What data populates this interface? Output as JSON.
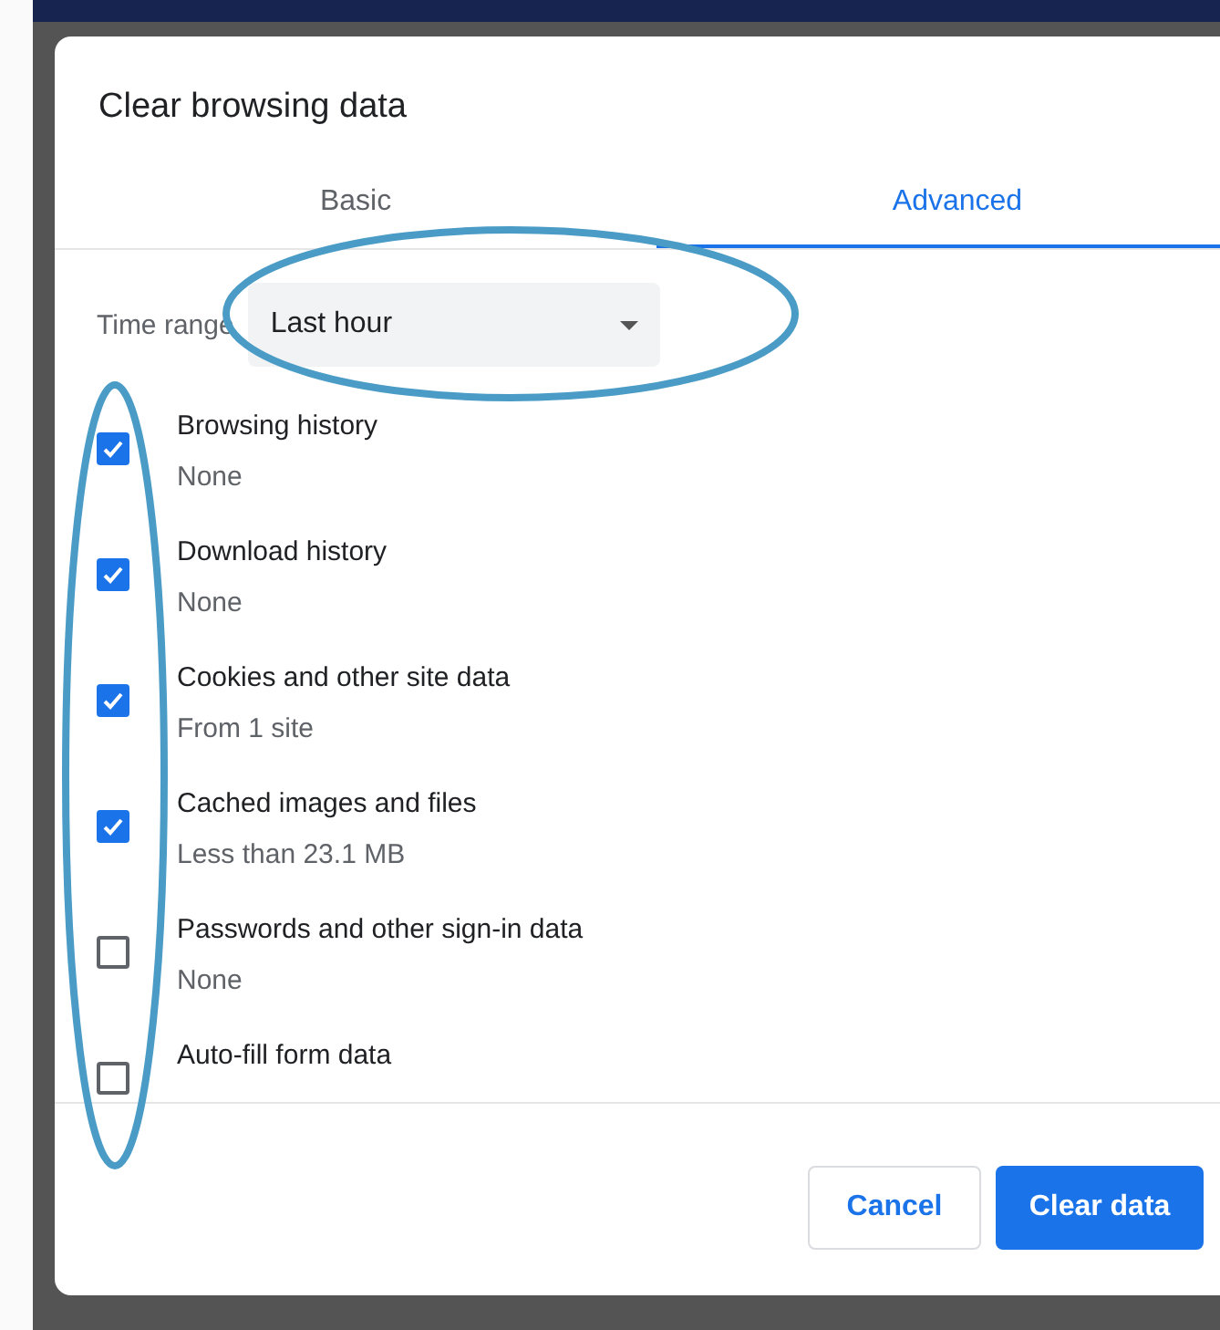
{
  "dialog": {
    "title": "Clear browsing data"
  },
  "tabs": [
    {
      "label": "Basic",
      "selected": false
    },
    {
      "label": "Advanced",
      "selected": true
    }
  ],
  "time_range": {
    "label": "Time range",
    "value": "Last hour"
  },
  "items": [
    {
      "label": "Browsing history",
      "detail": "None",
      "checked": true
    },
    {
      "label": "Download history",
      "detail": "None",
      "checked": true
    },
    {
      "label": "Cookies and other site data",
      "detail": "From 1 site",
      "checked": true
    },
    {
      "label": "Cached images and files",
      "detail": "Less than 23.1 MB",
      "checked": true
    },
    {
      "label": "Passwords and other sign-in data",
      "detail": "None",
      "checked": false
    },
    {
      "label": "Auto-fill form data",
      "checked": false
    }
  ],
  "buttons": [
    {
      "label": "Cancel",
      "kind": "secondary"
    },
    {
      "label": "Clear data",
      "kind": "primary"
    }
  ]
}
